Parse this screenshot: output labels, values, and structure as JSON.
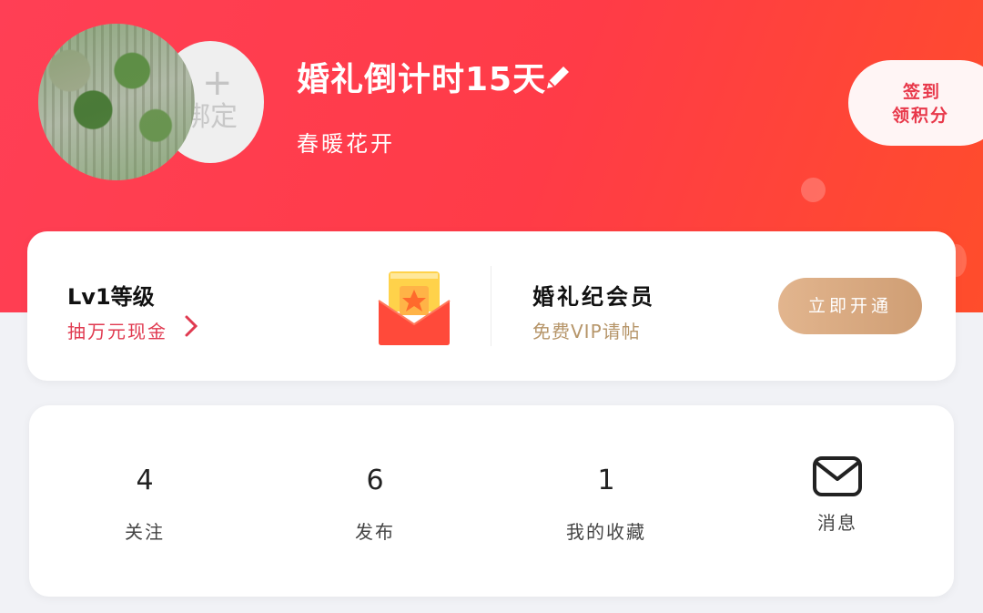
{
  "header": {
    "avatar_bind_text": "绑定",
    "title": "婚礼倒计时15天",
    "subtitle": "春暖花开",
    "checkin_line1": "签到",
    "checkin_line2": "领积分",
    "gradient_colors": [
      "#ff3f55",
      "#ff4d2b"
    ]
  },
  "level_card": {
    "level_title": "Lv1等级",
    "level_sub": "抽万元现金",
    "vip_title": "婚礼纪会员",
    "vip_sub": "免费VIP请帖",
    "open_button": "立即开通",
    "icons": [
      "chevron-right-icon",
      "red-envelope-icon"
    ]
  },
  "stats": [
    {
      "value": "4",
      "label": "关注"
    },
    {
      "value": "6",
      "label": "发布"
    },
    {
      "value": "1",
      "label": "我的收藏"
    },
    {
      "value": "",
      "label": "消息",
      "icon": "mail-icon"
    }
  ],
  "colors": {
    "accent_red": "#e03a50",
    "vip_gold": "#b69569",
    "button_gold": "#d8a980",
    "page_bg": "#f1f2f6"
  }
}
